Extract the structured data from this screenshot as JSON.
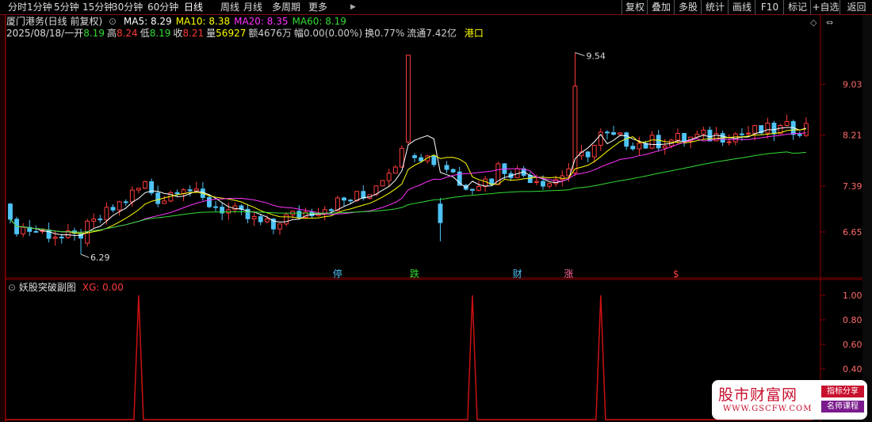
{
  "toolbar": {
    "periods": [
      "分时",
      "1分钟",
      "5分钟",
      "15分钟",
      "30分钟",
      "60分钟",
      "日线",
      "周线",
      "月线",
      "多周期",
      "更多"
    ],
    "active_period": "日线",
    "more_arrow": "▶",
    "right_buttons": [
      "复权",
      "叠加",
      "多股",
      "统计",
      "画线",
      "F10",
      "标记",
      "+自选",
      "返回"
    ]
  },
  "stock": {
    "name_line": "厦门港务(日线 前复权)",
    "ma_labels": [
      {
        "label": "MA5: 8.29",
        "color": "#ffffff"
      },
      {
        "label": "MA10: 8.38",
        "color": "#ffff00"
      },
      {
        "label": "MA20: 8.35",
        "color": "#ff33ff"
      },
      {
        "label": "MA60: 8.19",
        "color": "#33dd33"
      }
    ],
    "date": "2025/08/18/一",
    "quote": [
      {
        "k": "开",
        "v": "8.19",
        "color": "#33dd33"
      },
      {
        "k": "高",
        "v": "8.24",
        "color": "#ff3b3b"
      },
      {
        "k": "低",
        "v": "8.19",
        "color": "#33dd33"
      },
      {
        "k": "收",
        "v": "8.21",
        "color": "#ff3b3b"
      },
      {
        "k": "量",
        "v": "56927",
        "color": "#ffff00"
      },
      {
        "k": "额",
        "v": "4676万",
        "color": "#cccccc"
      },
      {
        "k": "幅",
        "v": "0.00(0.00%)",
        "color": "#cccccc"
      },
      {
        "k": "换",
        "v": "0.77%",
        "color": "#cccccc"
      },
      {
        "k": "流通",
        "v": "7.42亿",
        "color": "#cccccc"
      }
    ],
    "sector": "港口"
  },
  "price_axis": {
    "ticks": [
      9.03,
      8.21,
      7.39,
      6.65
    ],
    "min": 6.05,
    "max": 9.75
  },
  "annotations": {
    "high": "9.54",
    "low": "6.29"
  },
  "signals": [
    {
      "label": "停",
      "color": "#4fc3f7"
    },
    {
      "label": "跌",
      "color": "#33dd33"
    },
    {
      "label": "财",
      "color": "#4fc3f7"
    },
    {
      "label": "涨",
      "color": "#ff6b9a"
    },
    {
      "label": "$",
      "color": "#ff3b3b"
    }
  ],
  "indicator": {
    "title": "妖股突破副图",
    "xg_label": "XG: 0.00",
    "ticks": [
      "1.00",
      "0.80",
      "0.60",
      "0.40"
    ],
    "spike_bars": [
      20,
      72,
      92
    ]
  },
  "watermark": {
    "title": "股市财富网",
    "url": "WWW.GSCFW.COM",
    "tag1": "指标分享",
    "tag2": "名师课程"
  },
  "colors": {
    "up": "#ff3b3b",
    "down": "#4fc3f7",
    "ma5": "#ffffff",
    "ma10": "#ffff00",
    "ma20": "#ff33ff",
    "ma60": "#33dd33",
    "grid": "#8b0000",
    "spike": "#cc1111"
  }
}
